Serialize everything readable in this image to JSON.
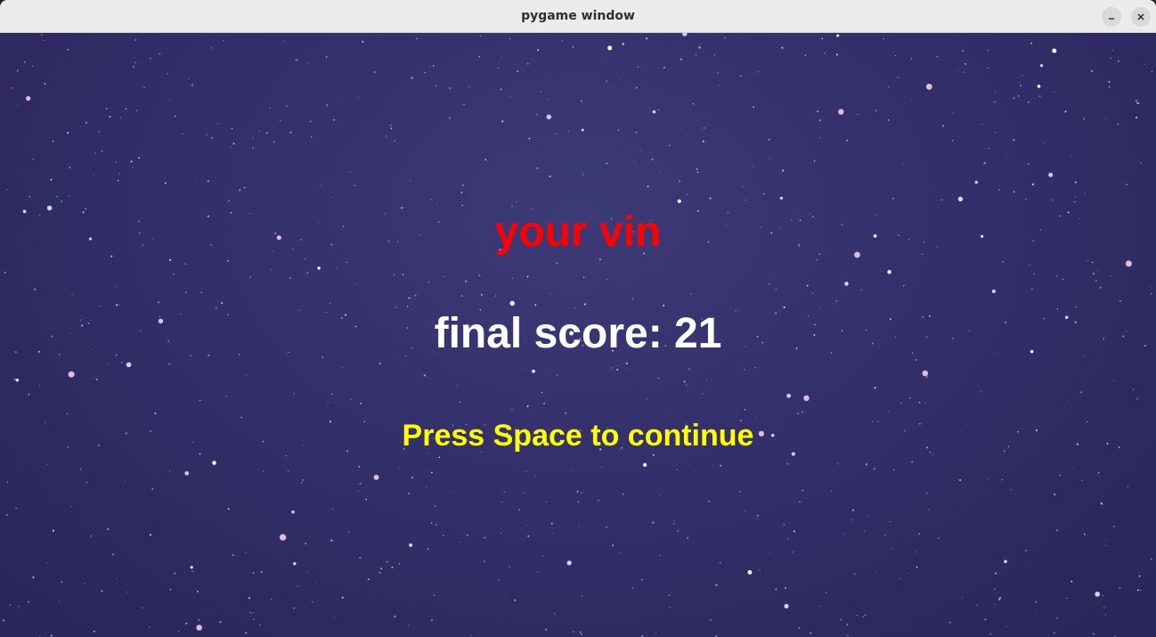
{
  "window": {
    "title": "pygame window",
    "controls": {
      "minimize_icon": "minimize-icon",
      "close_icon": "close-icon"
    }
  },
  "game": {
    "result_text": "your vin",
    "score_text": "final score: 21",
    "prompt_text": "Press Space to continue",
    "colors": {
      "result": "#ff0000",
      "score": "#ffffff",
      "prompt": "#ffff00",
      "background": "#332f6a"
    }
  }
}
